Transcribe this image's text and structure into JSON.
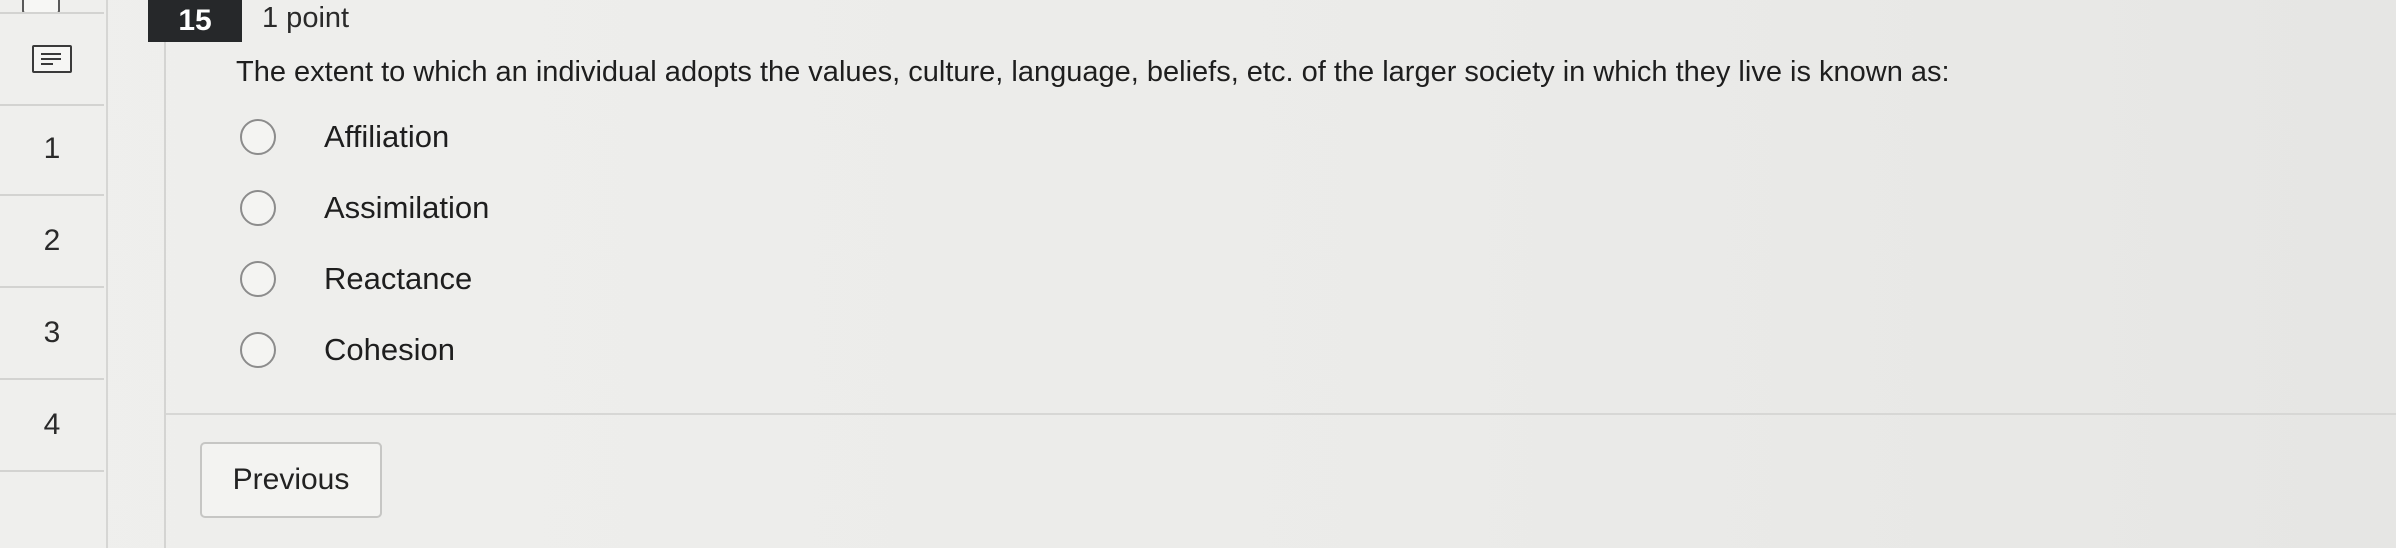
{
  "nav": {
    "items": [
      {
        "label": ""
      },
      {
        "label": "1"
      },
      {
        "label": "2"
      },
      {
        "label": "3"
      },
      {
        "label": "4"
      }
    ]
  },
  "question": {
    "number": "15",
    "points": "1 point",
    "text": "The extent to which an individual adopts the values, culture, language, beliefs, etc. of the larger society in which they live is known as:",
    "options": [
      {
        "label": "Affiliation",
        "selected": false
      },
      {
        "label": "Assimilation",
        "selected": false
      },
      {
        "label": "Reactance",
        "selected": false
      },
      {
        "label": "Cohesion",
        "selected": false
      }
    ]
  },
  "footer": {
    "previous_label": "Previous"
  }
}
